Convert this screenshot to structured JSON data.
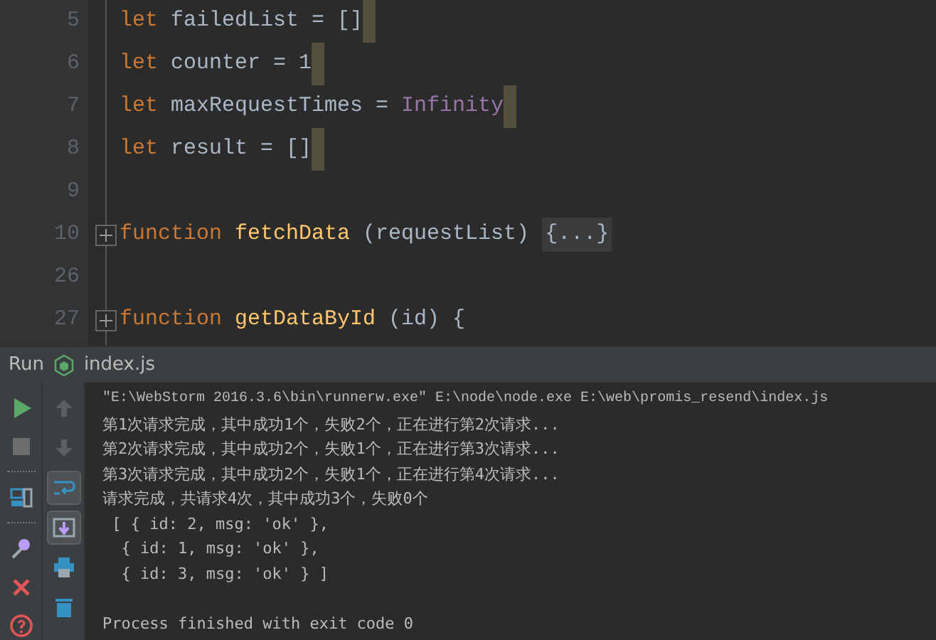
{
  "editor": {
    "lines": [
      {
        "number": "5",
        "marker": true,
        "fold": false,
        "tokens": [
          {
            "kind": "keyword",
            "text": "let"
          },
          {
            "kind": "plain",
            "text": " failedList = []"
          }
        ]
      },
      {
        "number": "6",
        "marker": true,
        "fold": false,
        "tokens": [
          {
            "kind": "keyword",
            "text": "let"
          },
          {
            "kind": "plain",
            "text": " counter = 1"
          }
        ]
      },
      {
        "number": "7",
        "marker": true,
        "fold": false,
        "tokens": [
          {
            "kind": "keyword",
            "text": "let"
          },
          {
            "kind": "plain",
            "text": " maxRequestTimes = "
          },
          {
            "kind": "constant",
            "text": "Infinity"
          }
        ]
      },
      {
        "number": "8",
        "marker": true,
        "fold": false,
        "tokens": [
          {
            "kind": "keyword",
            "text": "let"
          },
          {
            "kind": "plain",
            "text": " result = []"
          }
        ]
      },
      {
        "number": "9",
        "marker": false,
        "fold": false
      },
      {
        "number": "10",
        "marker": false,
        "fold": true,
        "tokens": [
          {
            "kind": "keyword",
            "text": "function"
          },
          {
            "kind": "function",
            "text": " fetchData"
          },
          {
            "kind": "plain",
            "text": " (requestList) "
          },
          {
            "kind": "folded",
            "text": "{...}"
          }
        ]
      },
      {
        "number": "26",
        "marker": false,
        "fold": false
      },
      {
        "number": "27",
        "marker": false,
        "fold": true,
        "tokens": [
          {
            "kind": "keyword",
            "text": "function"
          },
          {
            "kind": "function",
            "text": " getDataById"
          },
          {
            "kind": "plain",
            "text": " (id) {"
          }
        ]
      }
    ]
  },
  "run_panel": {
    "title": "Run",
    "file": "index.js",
    "left_tools": [
      {
        "kind": "run"
      },
      {
        "kind": "stop"
      },
      {
        "kind": "separator"
      },
      {
        "kind": "layout"
      },
      {
        "kind": "separator"
      },
      {
        "kind": "pin"
      },
      {
        "kind": "close"
      },
      {
        "kind": "help"
      }
    ],
    "right_tools": [
      {
        "kind": "up",
        "selected": false
      },
      {
        "kind": "down",
        "selected": false
      },
      {
        "kind": "wrap",
        "selected": true
      },
      {
        "kind": "scroll",
        "selected": true
      },
      {
        "kind": "print",
        "selected": false
      },
      {
        "kind": "trash",
        "selected": false
      }
    ],
    "console": [
      {
        "kind": "command",
        "text": "\"E:\\WebStorm 2016.3.6\\bin\\runnerw.exe\" E:\\node\\node.exe E:\\web\\promis_resend\\index.js"
      },
      {
        "kind": "output",
        "text": "第1次请求完成，其中成功1个，失败2个，正在进行第2次请求..."
      },
      {
        "kind": "output",
        "text": "第2次请求完成，其中成功2个，失败1个，正在进行第3次请求..."
      },
      {
        "kind": "output",
        "text": "第3次请求完成，其中成功2个，失败1个，正在进行第4次请求..."
      },
      {
        "kind": "output",
        "text": "请求完成，共请求4次，其中成功3个，失败0个"
      },
      {
        "kind": "output",
        "text": " [ { id: 2, msg: 'ok' },"
      },
      {
        "kind": "output",
        "text": "  { id: 1, msg: 'ok' },"
      },
      {
        "kind": "output",
        "text": "  { id: 3, msg: 'ok' } ]"
      },
      {
        "kind": "blank"
      },
      {
        "kind": "output",
        "text": "Process finished with exit code 0"
      }
    ]
  }
}
